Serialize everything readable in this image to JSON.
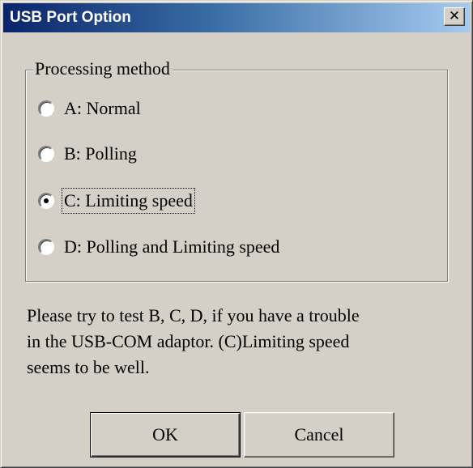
{
  "window": {
    "title": "USB Port Option",
    "close_glyph": "✕",
    "close_icon": "close-icon"
  },
  "group": {
    "label": "Processing method",
    "options": [
      {
        "label": "A: Normal",
        "selected": false
      },
      {
        "label": "B: Polling",
        "selected": false
      },
      {
        "label": "C: Limiting speed",
        "selected": true
      },
      {
        "label": "D: Polling and Limiting speed",
        "selected": false
      }
    ]
  },
  "message": {
    "line1": "Please try to test B, C, D, if you have a trouble",
    "line2": "in the USB-COM adaptor. (C)Limiting speed",
    "line3": "seems to be well."
  },
  "buttons": {
    "ok_label": "OK",
    "cancel_label": "Cancel"
  },
  "colors": {
    "titlebar_start": "#0a246a",
    "titlebar_end": "#a6caf0",
    "face": "#d4d0c8"
  }
}
